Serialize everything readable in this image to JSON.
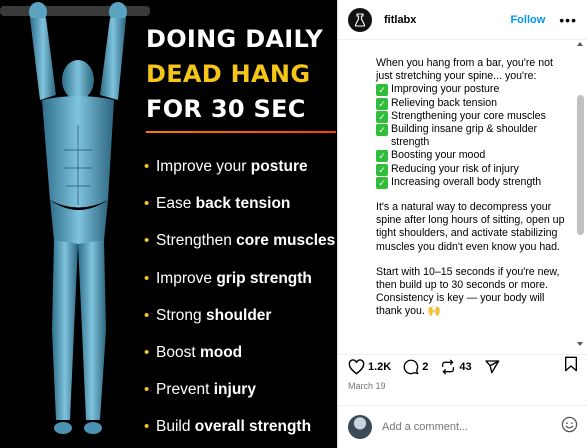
{
  "post_image": {
    "headline": [
      "DOING DAILY",
      "DEAD HANG",
      "FOR 30 SEC"
    ],
    "benefits": [
      {
        "pre": "Improve your ",
        "bold": "posture"
      },
      {
        "pre": "Ease ",
        "bold": "back tension"
      },
      {
        "pre": "Strengthen ",
        "bold": "core muscles"
      },
      {
        "pre": "Improve ",
        "bold": "grip strength"
      },
      {
        "pre": "Strong ",
        "bold": "shoulder"
      },
      {
        "pre": "Boost ",
        "bold": "mood"
      },
      {
        "pre": "Prevent ",
        "bold": "injury"
      },
      {
        "pre": "Build ",
        "bold": "overall strength"
      }
    ]
  },
  "header": {
    "username": "fitlabx",
    "follow_label": "Follow",
    "more_label": "•••"
  },
  "caption": {
    "intro": "When you hang from a bar, you're not just stretching your spine... you're:",
    "checks": [
      "Improving your posture",
      "Relieving back tension",
      "Strengthening your core muscles",
      "Building insane grip & shoulder strength",
      "Boosting your mood",
      "Reducing your risk of injury",
      "Increasing overall body strength"
    ],
    "para2": "It's a natural way to decompress your spine after long hours of sitting, open up tight shoulders, and activate stabilizing muscles you didn't even know you had.",
    "para3": "Start with 10–15 seconds if you're new, then build up to 30 seconds or more. Consistency is key — your body will thank you. 🙌"
  },
  "actions": {
    "likes": "1.2K",
    "comments": "2",
    "reposts": "43"
  },
  "date": "March 19",
  "comment": {
    "placeholder": "Add a comment..."
  },
  "colors": {
    "accent_yellow": "#f5c518",
    "follow_blue": "#0095f6",
    "check_green": "#2fbd3a"
  }
}
